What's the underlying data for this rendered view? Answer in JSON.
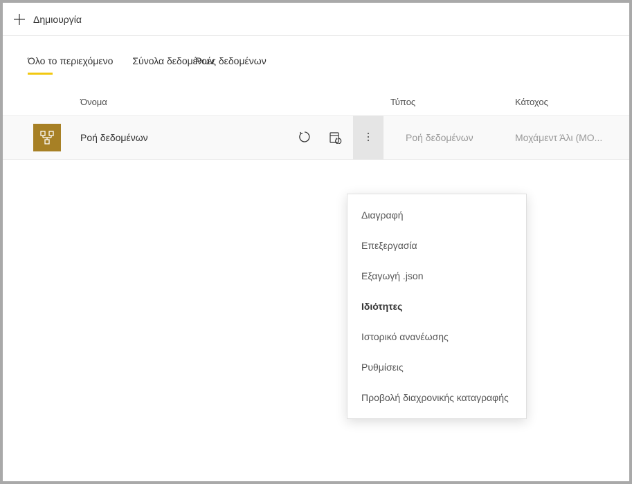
{
  "toolbar": {
    "create_label": "Δημιουργία"
  },
  "tabs": {
    "all_content": "Όλο το περιεχόμενο",
    "datasets": "Σύνολα δεδομένων",
    "dataflows": "Ροές δεδομένων"
  },
  "columns": {
    "name": "Όνομα",
    "type": "Τύπος",
    "owner": "Κάτοχος"
  },
  "row": {
    "name": "Ροή δεδομένων",
    "type": "Ροή δεδομένων",
    "owner": "Μοχάμεντ Άλι (MO..."
  },
  "menu": {
    "delete": "Διαγραφή",
    "edit": "Επεξεργασία",
    "export_json": "Εξαγωγή .json",
    "properties": "Ιδιότητες",
    "refresh_history": "Ιστορικό ανανέωσης",
    "settings": "Ρυθμίσεις",
    "lineage_view": "Προβολή διαχρονικής καταγραφής"
  }
}
